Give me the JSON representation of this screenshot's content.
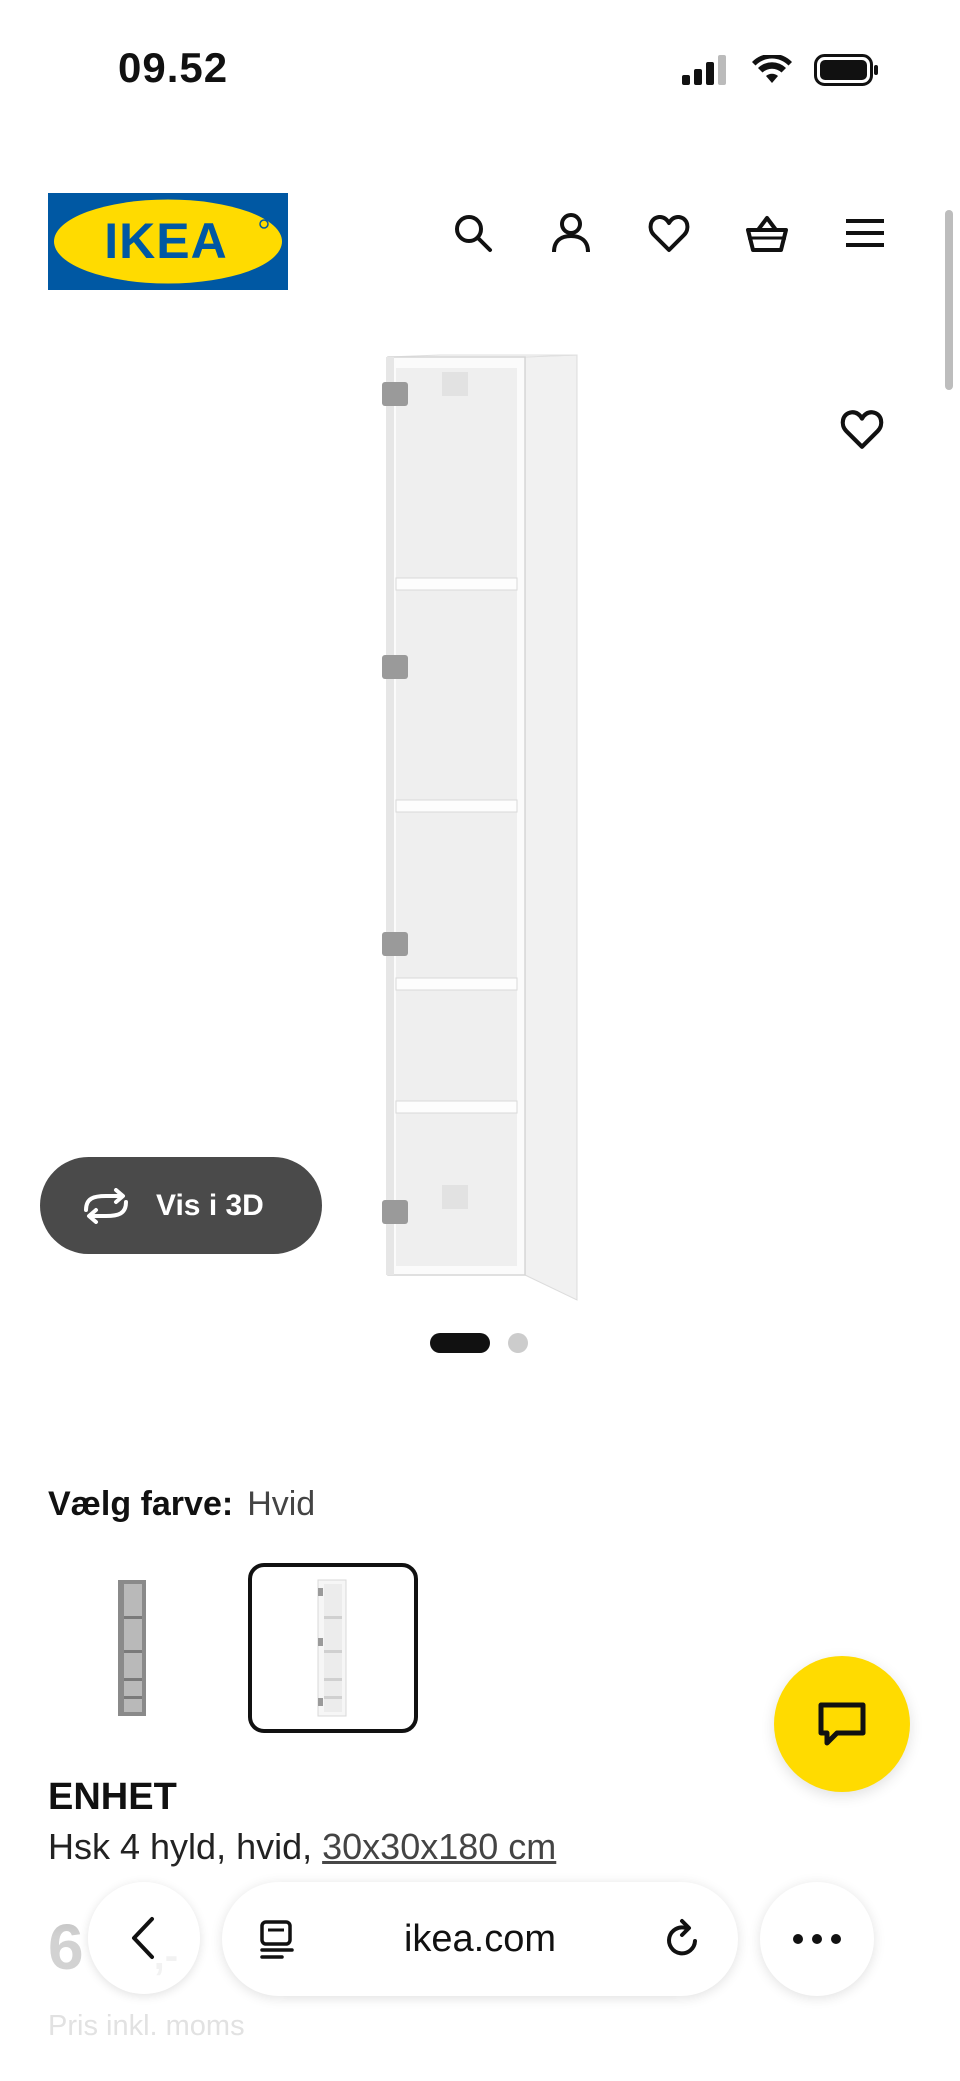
{
  "status_bar": {
    "time": "09.52",
    "icons": [
      "cellular-signal-icon",
      "wifi-icon",
      "battery-icon"
    ]
  },
  "header": {
    "logo_text": "IKEA",
    "icons": [
      "search-icon",
      "account-icon",
      "heart-icon",
      "shopping-basket-icon",
      "menu-icon"
    ]
  },
  "gallery": {
    "favorite_icon": "heart-icon",
    "view_3d_label": "Vis i 3D",
    "view_3d_icon": "rotate-3d-icon",
    "slide_count": 2,
    "active_slide": 1
  },
  "color_picker": {
    "label": "Vælg farve:",
    "selected_value": "Hvid",
    "options": [
      {
        "name": "grey-swatch",
        "selected": false
      },
      {
        "name": "white-swatch",
        "selected": true
      }
    ]
  },
  "product": {
    "name": "ENHET",
    "description": "Hsk 4 hyld, hvid, ",
    "dimensions": "30x30x180 cm",
    "price_visible": "6",
    "price_suffix": ",-",
    "price_note": "Pris inkl. moms"
  },
  "chat": {
    "icon": "chat-icon"
  },
  "browser": {
    "url": "ikea.com",
    "icons": [
      "back-icon",
      "reader-icon",
      "reload-icon",
      "more-icon"
    ]
  },
  "colors": {
    "ikea_blue": "#0058a3",
    "ikea_yellow": "#ffdb00",
    "view3d_bg": "#4a4a4a"
  }
}
